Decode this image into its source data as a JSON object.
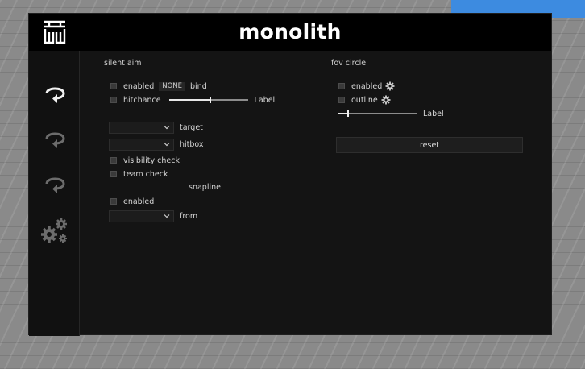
{
  "window": {
    "title": "monolith"
  },
  "sidebar": {
    "items": [
      {
        "icon": "rotate-arrow-icon",
        "active": true
      },
      {
        "icon": "rotate-arrow-icon",
        "active": false
      },
      {
        "icon": "rotate-arrow-icon",
        "active": false
      },
      {
        "icon": "gears-icon",
        "active": false
      }
    ]
  },
  "silent_aim": {
    "title": "silent aim",
    "enabled_label": "enabled",
    "bind_value": "NONE",
    "bind_label": "bind",
    "hitchance_label": "hitchance",
    "hitchance_slider_value": 0.52,
    "hitchance_slider_label": "Label",
    "target_label": "target",
    "target_value": "",
    "hitbox_label": "hitbox",
    "hitbox_value": "",
    "visibility_check_label": "visibility check",
    "team_check_label": "team check"
  },
  "snapline": {
    "title": "snapline",
    "enabled_label": "enabled",
    "from_label": "from",
    "from_value": ""
  },
  "fov_circle": {
    "title": "fov circle",
    "enabled_label": "enabled",
    "outline_label": "outline",
    "slider_value": 0.13,
    "slider_label": "Label",
    "reset_label": "reset"
  },
  "colors": {
    "window_bg": "#141414",
    "titlebar_bg": "#000000",
    "sky": "#3d8be0",
    "ground": "#8a8a8a"
  }
}
